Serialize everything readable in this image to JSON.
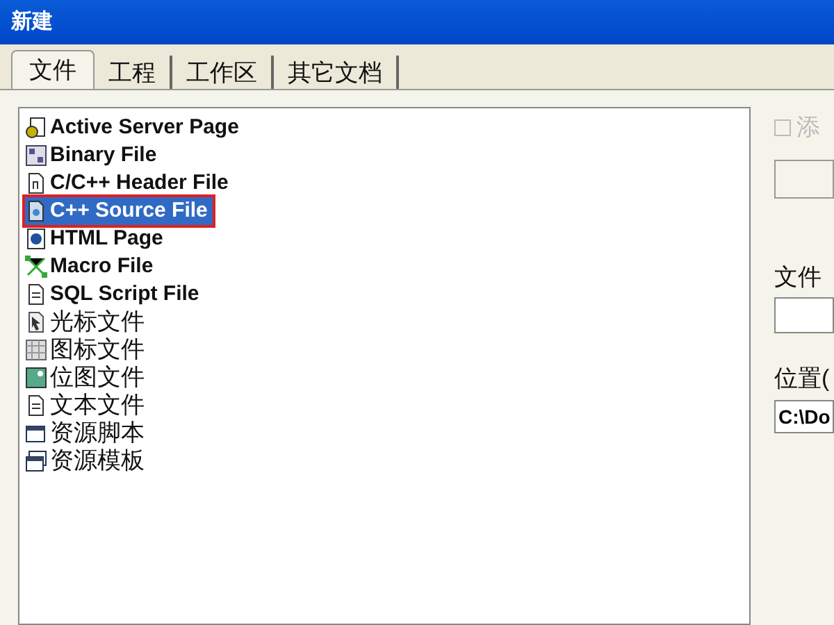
{
  "window": {
    "title": "新建"
  },
  "tabs": [
    {
      "label": "文件",
      "selected": true
    },
    {
      "label": "工程",
      "selected": false
    },
    {
      "label": "工作区",
      "selected": false
    },
    {
      "label": "其它文档",
      "selected": false
    }
  ],
  "file_types": [
    {
      "label": "Active Server Page",
      "selected": false
    },
    {
      "label": "Binary File",
      "selected": false
    },
    {
      "label": "C/C++ Header File",
      "selected": false
    },
    {
      "label": "C++ Source File",
      "selected": true
    },
    {
      "label": "HTML Page",
      "selected": false
    },
    {
      "label": "Macro File",
      "selected": false
    },
    {
      "label": "SQL Script File",
      "selected": false
    },
    {
      "label": "光标文件",
      "selected": false
    },
    {
      "label": "图标文件",
      "selected": false
    },
    {
      "label": "位图文件",
      "selected": false
    },
    {
      "label": "文本文件",
      "selected": false
    },
    {
      "label": "资源脚本",
      "selected": false
    },
    {
      "label": "资源模板",
      "selected": false
    }
  ],
  "add_to_project": {
    "label": "添",
    "checked": false,
    "disabled": true
  },
  "file_name": {
    "label": "文件"
  },
  "location": {
    "label": "位置(",
    "value": "C:\\Do"
  }
}
